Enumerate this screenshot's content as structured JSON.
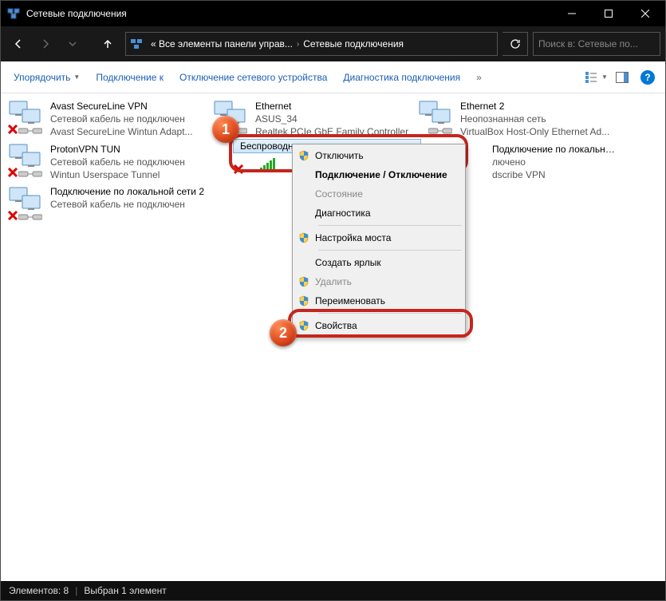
{
  "window": {
    "title": "Сетевые подключения"
  },
  "breadcrumb": {
    "part1": "« Все элементы панели управ...",
    "part2": "Сетевые подключения"
  },
  "search": {
    "placeholder": "Поиск в: Сетевые по..."
  },
  "toolbar": {
    "organize": "Упорядочить",
    "connect": "Подключение к",
    "disable": "Отключение сетевого устройства",
    "diagnose": "Диагностика подключения"
  },
  "connections": [
    {
      "name": "Avast SecureLine VPN",
      "line2": "Сетевой кабель не подключен",
      "line3": "Avast SecureLine Wintun Adapt...",
      "x": true
    },
    {
      "name": "Ethernet",
      "line2": "ASUS_34",
      "line3": "Realtek PCIe GbE Family Controller",
      "x": false
    },
    {
      "name": "Ethernet 2",
      "line2": "Неопознанная сеть",
      "line3": "VirtualBox Host-Only Ethernet Ad...",
      "x": false
    },
    {
      "name": "ProtonVPN TUN",
      "line2": "Сетевой кабель не подключен",
      "line3": "Wintun Userspace Tunnel",
      "x": true
    },
    {
      "name": "Беспроводная сеть",
      "line2": "",
      "line3": "",
      "x": true,
      "selected": true
    },
    {
      "name": "Подключение по локальной сети",
      "line2": "лючено",
      "line3": "dscribe VPN",
      "x": false,
      "obscured": true
    },
    {
      "name": "Подключение по локальной сети 2",
      "line2": "Сетевой кабель не подключен",
      "line3": "",
      "x": true,
      "twoline": true
    }
  ],
  "selected_header": "Беспроводная сеть",
  "context_menu": [
    {
      "label": "Отключить",
      "shield": true
    },
    {
      "label": "Подключение / Отключение",
      "bold": true
    },
    {
      "label": "Состояние",
      "disabled": true
    },
    {
      "label": "Диагностика"
    },
    {
      "sep": true
    },
    {
      "label": "Настройка моста",
      "shield": true
    },
    {
      "sep": true
    },
    {
      "label": "Создать ярлык"
    },
    {
      "label": "Удалить",
      "shield": true,
      "disabled": true
    },
    {
      "label": "Переименовать",
      "shield": true
    },
    {
      "sep": true
    },
    {
      "label": "Свойства",
      "shield": true
    }
  ],
  "badges": {
    "b1": "1",
    "b2": "2"
  },
  "status": {
    "count": "Элементов: 8",
    "selection": "Выбран 1 элемент"
  }
}
